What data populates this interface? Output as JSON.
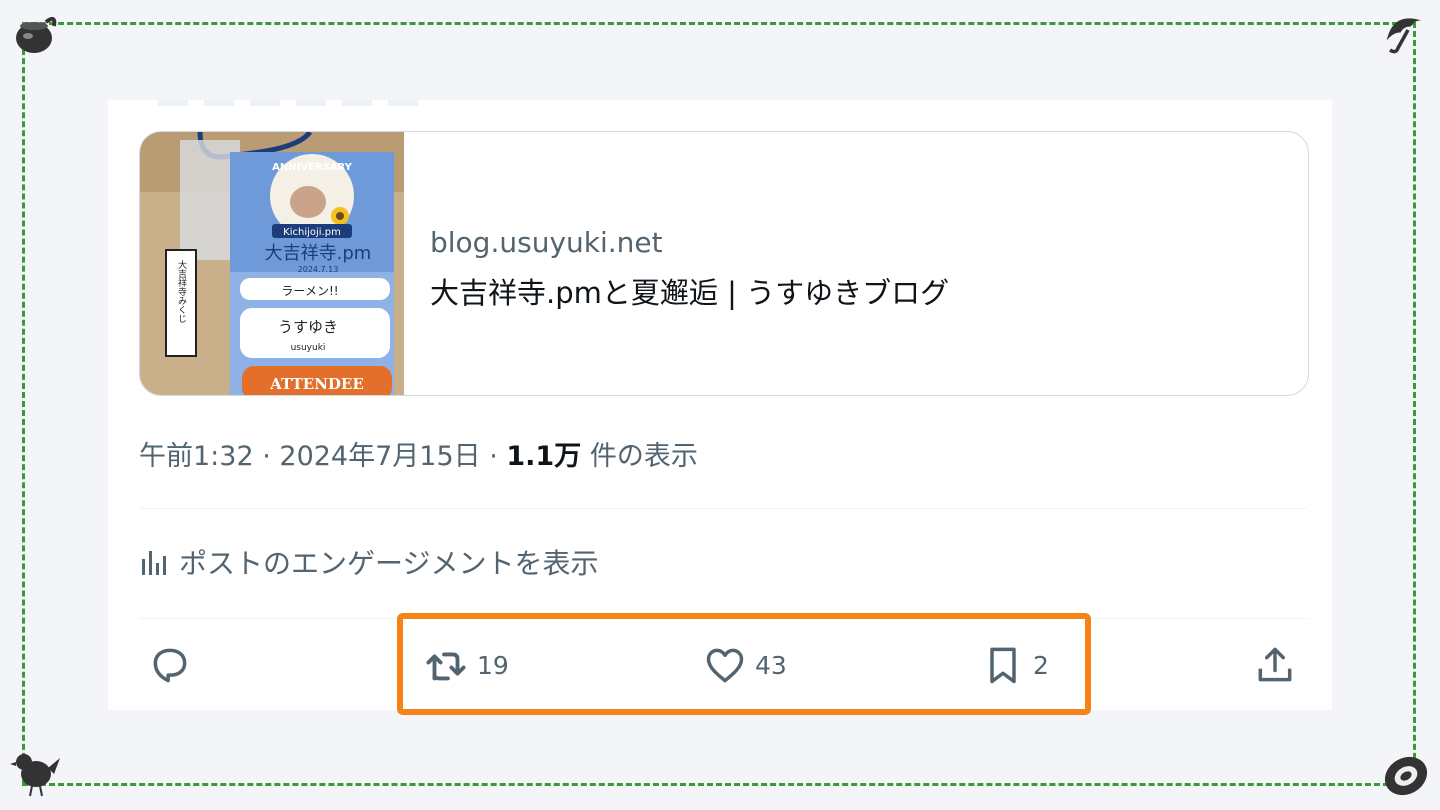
{
  "colors": {
    "background": "#f3f5f9",
    "frame_border": "#3a9a3a",
    "highlight_border": "#f58317",
    "text_primary": "#0f1419",
    "text_secondary": "#536471"
  },
  "corner_icons": [
    "pot-icon",
    "umbrella-icon",
    "bird-icon",
    "tire-icon"
  ],
  "link_card": {
    "domain": "blog.usuyuki.net",
    "title": "大吉祥寺.pmと夏邂逅 | うすゆきブログ",
    "thumbnail": {
      "badge_title": "Kichijoji.pm",
      "badge_event": "大吉祥寺.pm",
      "badge_date": "2024.7.13",
      "badge_answer": "ラーメン!!",
      "badge_name": "うすゆき",
      "badge_name_roman": "usuyuki",
      "badge_role": "ATTENDEE",
      "omikuji": "大吉祥寺みくじ"
    }
  },
  "meta": {
    "time": "午前1:32",
    "date": "2024年7月15日",
    "views": "1.1万",
    "views_suffix": "件の表示",
    "separator": " · "
  },
  "engagement": {
    "icon": "bar-chart-icon",
    "label": "ポストのエンゲージメントを表示"
  },
  "actions": {
    "reply": {
      "icon": "reply-icon",
      "count": ""
    },
    "retweet": {
      "icon": "retweet-icon",
      "count": "19"
    },
    "like": {
      "icon": "heart-icon",
      "count": "43"
    },
    "bookmark": {
      "icon": "bookmark-icon",
      "count": "2"
    },
    "share": {
      "icon": "share-icon",
      "count": ""
    }
  }
}
